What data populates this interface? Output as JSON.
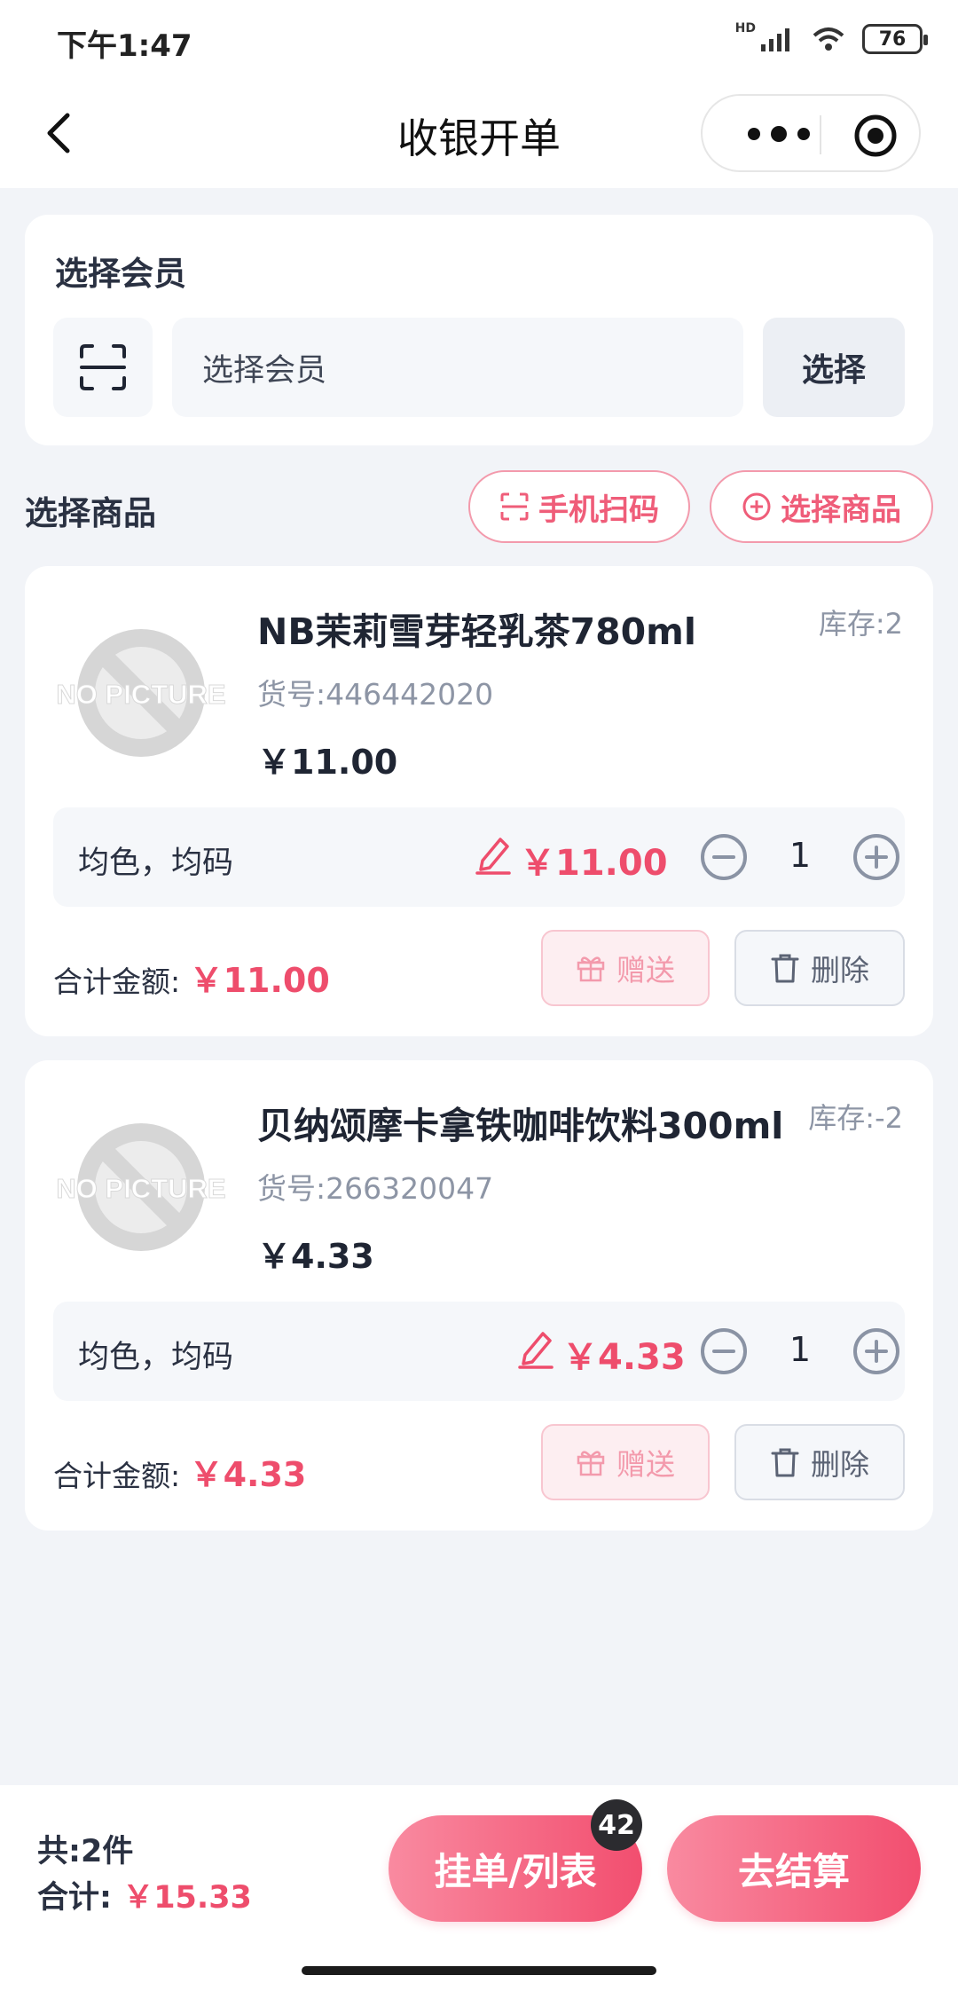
{
  "status_bar": {
    "time": "下午1:47",
    "battery": "76",
    "network": "HD"
  },
  "nav": {
    "title": "收银开单"
  },
  "member": {
    "section_title": "选择会员",
    "input_placeholder": "选择会员",
    "select_button": "选择"
  },
  "goods": {
    "section_title": "选择商品",
    "scan_button": "手机扫码",
    "select_button": "选择商品"
  },
  "products": [
    {
      "name": "NB茉莉雪芽轻乳茶780ml",
      "stock": "库存:2",
      "sku": "货号:446442020",
      "price": "￥11.00",
      "spec": "均色，均码",
      "row_price": "￥11.00",
      "qty": "1",
      "total_label": "合计金额: ",
      "total_value": "￥11.00",
      "gift_label": "赠送",
      "delete_label": "删除",
      "image_text": "NO PICTURE"
    },
    {
      "name": "贝纳颂摩卡拿铁咖啡饮料300ml",
      "stock": "库存:-2",
      "sku": "货号:266320047",
      "price": "￥4.33",
      "spec": "均色，均码",
      "row_price": "￥4.33",
      "qty": "1",
      "total_label": "合计金额: ",
      "total_value": "￥4.33",
      "gift_label": "赠送",
      "delete_label": "删除",
      "image_text": "NO PICTURE"
    }
  ],
  "footer": {
    "count": "共:2件",
    "sum_label": "合计: ",
    "sum_value": "￥15.33",
    "hang_button": "挂单/列表",
    "hang_badge": "42",
    "checkout_button": "去结算"
  },
  "colors": {
    "accent": "#ee4d6c",
    "background": "#f2f4f8"
  }
}
